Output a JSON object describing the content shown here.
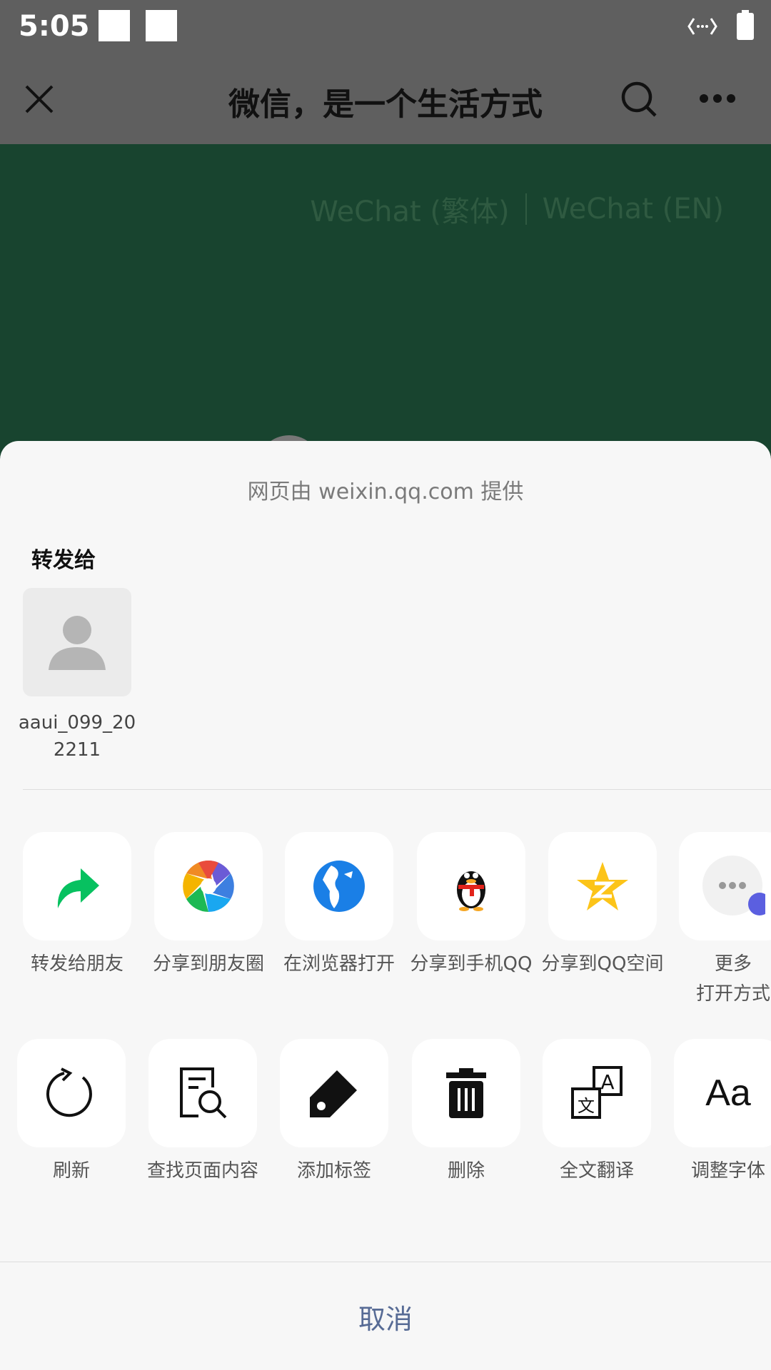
{
  "status": {
    "time": "5:05"
  },
  "topbar": {
    "title": "微信，是一个生活方式"
  },
  "page": {
    "lang_tc": "WeChat (繁体)",
    "lang_en": "WeChat (EN)"
  },
  "sheet": {
    "provider": "网页由 weixin.qq.com 提供",
    "forward_title": "转发给",
    "contact": {
      "name": "aaui_099_202211"
    },
    "row1": [
      {
        "icon": "forward-icon",
        "label": "转发给朋友"
      },
      {
        "icon": "moments-icon",
        "label": "分享到朋友圈"
      },
      {
        "icon": "browser-icon",
        "label": "在浏览器打开"
      },
      {
        "icon": "qq-icon",
        "label": "分享到手机QQ"
      },
      {
        "icon": "qzone-icon",
        "label": "分享到QQ空间"
      },
      {
        "icon": "more-icon",
        "label": "更多\n打开方式"
      }
    ],
    "row2": [
      {
        "icon": "refresh-icon",
        "label": "刷新"
      },
      {
        "icon": "find-in-page-icon",
        "label": "查找页面内容"
      },
      {
        "icon": "tag-icon",
        "label": "添加标签"
      },
      {
        "icon": "trash-icon",
        "label": "删除"
      },
      {
        "icon": "translate-icon",
        "label": "全文翻译"
      },
      {
        "icon": "font-size-icon",
        "label": "调整字体",
        "glyph": "Aa"
      }
    ],
    "cancel": "取消"
  },
  "colors": {
    "green": "#18442f",
    "link": "#576b95",
    "wechat_green": "#07c160"
  }
}
